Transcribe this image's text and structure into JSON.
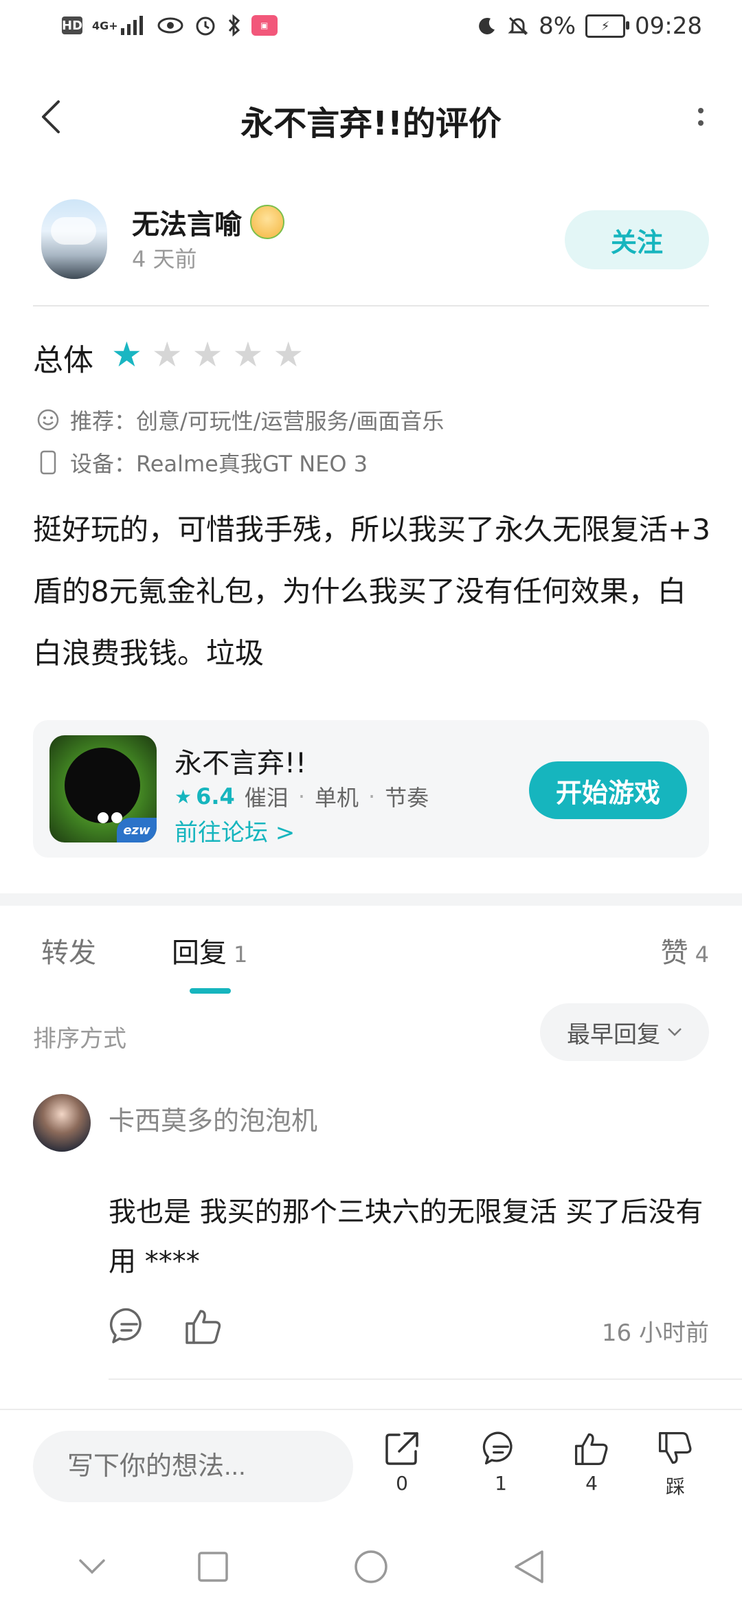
{
  "status_bar": {
    "hd": "HD",
    "network": "4G+",
    "battery": "8%",
    "time": "09:28"
  },
  "header": {
    "title": "永不言弃!!的评价"
  },
  "author": {
    "name": "无法言喻",
    "time": "4 天前",
    "follow_label": "关注"
  },
  "rating": {
    "label": "总体",
    "stars": 1,
    "max": 5
  },
  "meta": {
    "recommend": "推荐：创意/可玩性/运营服务/画面音乐",
    "device": "设备：Realme真我GT NEO 3"
  },
  "review_text": "挺好玩的，可惜我手残，所以我买了永久无限复活+3盾的8元氪金礼包，为什么我买了没有任何效果，白白浪费我钱。垃圾",
  "game": {
    "name": "永不言弃!!",
    "score": "6.4",
    "tags": [
      "催泪",
      "单机",
      "节奏"
    ],
    "forum_link": "前往论坛 >",
    "play_label": "开始游戏",
    "icon_badge": "ezw"
  },
  "tabs": {
    "forward": "转发",
    "reply": "回复",
    "reply_count": "1",
    "like": "赞",
    "like_count": "4"
  },
  "sort": {
    "label": "排序方式",
    "selected": "最早回复"
  },
  "reply": {
    "name": "卡西莫多的泡泡机",
    "text": "我也是 我买的那个三块六的无限复活 买了后没有用 ****",
    "time": "16 小时前"
  },
  "bottom_bar": {
    "placeholder": "写下你的想法...",
    "share_count": "0",
    "comment_count": "1",
    "like_count": "4",
    "dislike_label": "踩"
  },
  "colors": {
    "accent": "#16b5be",
    "accent_light": "#e3f6f6",
    "muted": "#888888"
  }
}
